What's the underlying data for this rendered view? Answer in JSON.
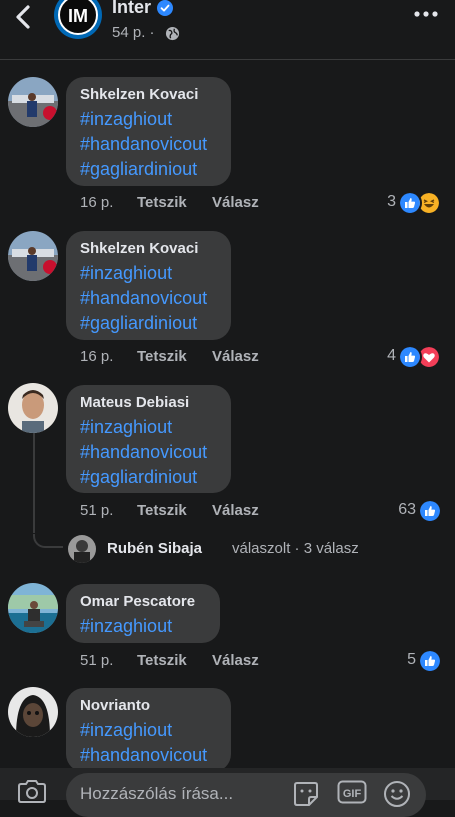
{
  "header": {
    "title": "Inter",
    "meta": "54 p. ·",
    "back_icon": "chevron-left-icon",
    "more_icon": "more-horizontal-icon",
    "privacy_icon": "globe-icon"
  },
  "comments": [
    {
      "author": "Shkelzen Kovaci",
      "tags": [
        "#inzaghiout",
        "#handanovicout",
        "#gagliardiniout"
      ],
      "time": "16 p.",
      "like": "Tetszik",
      "reply": "Válasz",
      "reactions": "3",
      "reaction_icons": [
        "like-icon",
        "haha-icon"
      ]
    },
    {
      "author": "Shkelzen Kovaci",
      "tags": [
        "#inzaghiout",
        "#handanovicout",
        "#gagliardiniout"
      ],
      "time": "16 p.",
      "like": "Tetszik",
      "reply": "Válasz",
      "reactions": "4",
      "reaction_icons": [
        "like-icon",
        "love-icon"
      ]
    },
    {
      "author": "Mateus Debiasi",
      "tags": [
        "#inzaghiout",
        "#handanovicout",
        "#gagliardiniout"
      ],
      "time": "51 p.",
      "like": "Tetszik",
      "reply": "Válasz",
      "reactions": "63",
      "reaction_icons": [
        "like-icon"
      ]
    },
    {
      "author": "Omar Pescatore",
      "tags": [
        "#inzaghiout"
      ],
      "time": "51 p.",
      "like": "Tetszik",
      "reply": "Válasz",
      "reactions": "5",
      "reaction_icons": [
        "like-icon"
      ]
    },
    {
      "author": "Novrianto",
      "tags": [
        "#inzaghiout",
        "#handanovicout"
      ]
    }
  ],
  "reply_summary": {
    "name": "Rubén Sibaja",
    "text": "válaszolt · 3 válasz"
  },
  "composer": {
    "placeholder": "Hozzászólás írása...",
    "gif_label": "GIF"
  },
  "colors": {
    "background": "#18191a",
    "bubble": "#3a3b3c",
    "hashtag": "#4599ff",
    "like_blue": "#2d88ff",
    "love_red": "#f33e58",
    "haha_yellow": "#f7b125"
  }
}
